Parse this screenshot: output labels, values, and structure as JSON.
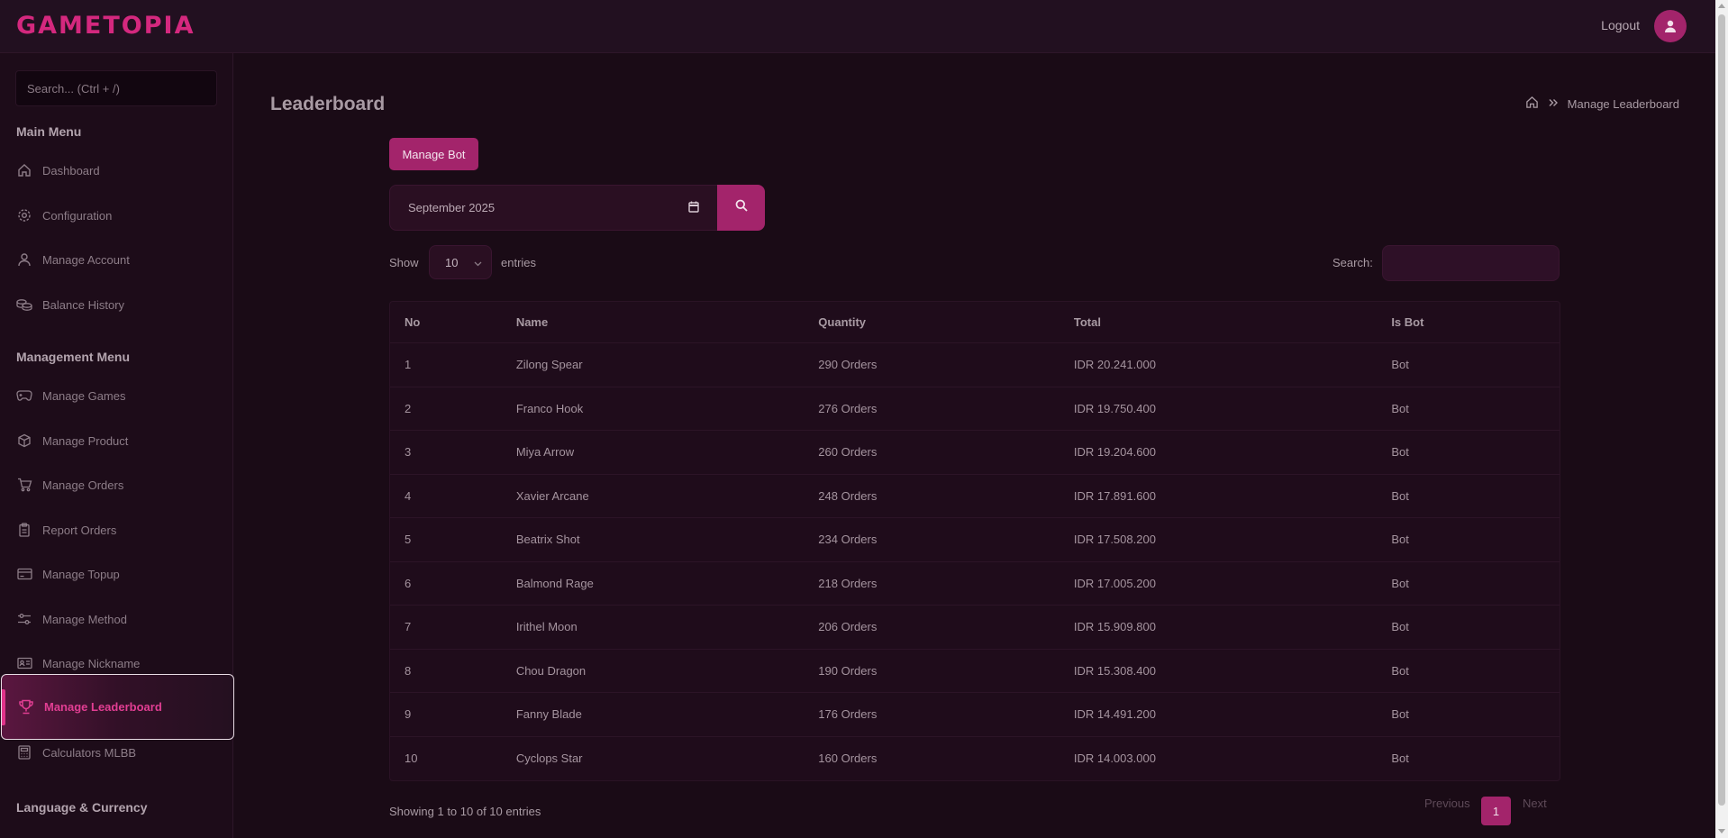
{
  "brand": "GAMETOPIA",
  "topbar": {
    "logout_label": "Logout"
  },
  "sidebar": {
    "search_placeholder": "Search... (Ctrl + /)",
    "main_menu_title": "Main Menu",
    "main_items": [
      {
        "label": "Dashboard",
        "icon": "home-icon"
      },
      {
        "label": "Configuration",
        "icon": "gear-icon"
      },
      {
        "label": "Manage Account",
        "icon": "user-icon"
      },
      {
        "label": "Balance History",
        "icon": "coins-icon"
      }
    ],
    "management_menu_title": "Management Menu",
    "management_items": [
      {
        "label": "Manage Games",
        "icon": "gamepad-icon"
      },
      {
        "label": "Manage Product",
        "icon": "box-icon"
      },
      {
        "label": "Manage Orders",
        "icon": "cart-icon"
      },
      {
        "label": "Report Orders",
        "icon": "clipboard-icon"
      },
      {
        "label": "Manage Topup",
        "icon": "card-icon"
      },
      {
        "label": "Manage Method",
        "icon": "sliders-icon"
      },
      {
        "label": "Manage Nickname",
        "icon": "id-card-icon"
      },
      {
        "label": "Manage Leaderboard",
        "icon": "trophy-icon",
        "active": true
      },
      {
        "label": "Calculators MLBB",
        "icon": "calculator-icon"
      }
    ],
    "language_title": "Language & Currency"
  },
  "page": {
    "title": "Leaderboard",
    "breadcrumb_current": "Manage Leaderboard",
    "manage_bot_label": "Manage Bot",
    "month_value": "September 2025",
    "show_label": "Show",
    "entries_value": "10",
    "entries_label": "entries",
    "search_label": "Search:",
    "table": {
      "headers": [
        "No",
        "Name",
        "Quantity",
        "Total",
        "Is Bot"
      ],
      "rows": [
        [
          "1",
          "Zilong Spear",
          "290 Orders",
          "IDR 20.241.000",
          "Bot"
        ],
        [
          "2",
          "Franco Hook",
          "276 Orders",
          "IDR 19.750.400",
          "Bot"
        ],
        [
          "3",
          "Miya Arrow",
          "260 Orders",
          "IDR 19.204.600",
          "Bot"
        ],
        [
          "4",
          "Xavier Arcane",
          "248 Orders",
          "IDR 17.891.600",
          "Bot"
        ],
        [
          "5",
          "Beatrix Shot",
          "234 Orders",
          "IDR 17.508.200",
          "Bot"
        ],
        [
          "6",
          "Balmond Rage",
          "218 Orders",
          "IDR 17.005.200",
          "Bot"
        ],
        [
          "7",
          "Irithel Moon",
          "206 Orders",
          "IDR 15.909.800",
          "Bot"
        ],
        [
          "8",
          "Chou Dragon",
          "190 Orders",
          "IDR 15.308.400",
          "Bot"
        ],
        [
          "9",
          "Fanny Blade",
          "176 Orders",
          "IDR 14.491.200",
          "Bot"
        ],
        [
          "10",
          "Cyclops Star",
          "160 Orders",
          "IDR 14.003.000",
          "Bot"
        ]
      ]
    },
    "showing_text": "Showing 1 to 10 of 10 entries",
    "pagination": {
      "previous": "Previous",
      "current": "1",
      "next": "Next"
    }
  },
  "colors": {
    "accent": "#a3246b",
    "brand": "#d4287e",
    "background": "#1a0b16"
  }
}
